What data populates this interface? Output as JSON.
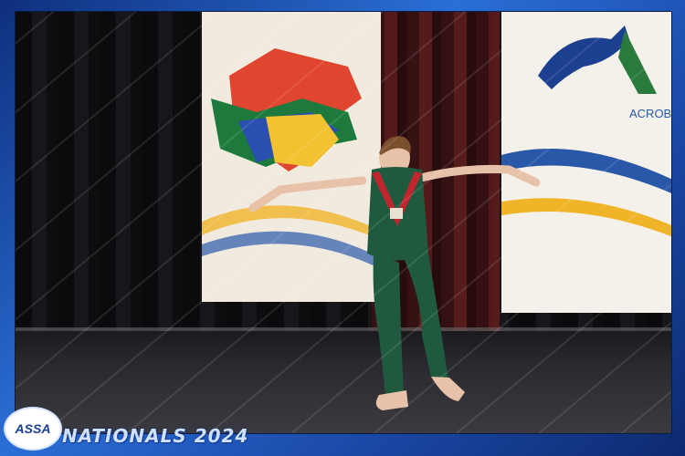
{
  "event": {
    "title": "NATIONALS 2024",
    "logo_text": "ASSA",
    "banner_text": "ACROB"
  },
  "colors": {
    "frame_blue": "#1d3f8f",
    "costume_green": "#1f5a3f",
    "costume_red": "#c0262d"
  }
}
